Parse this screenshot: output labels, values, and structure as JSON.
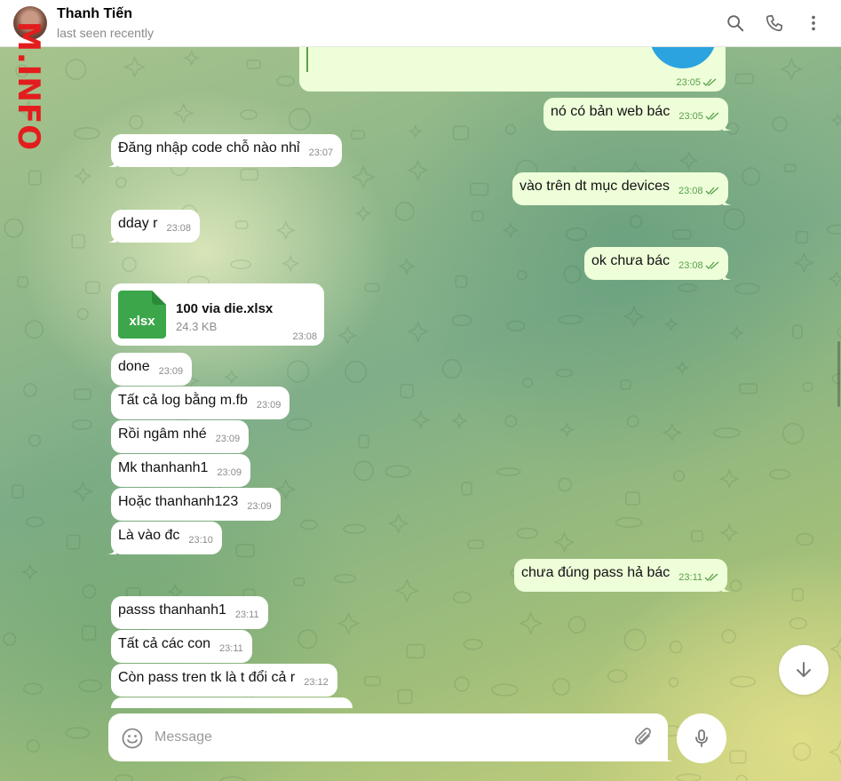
{
  "header": {
    "contact_name": "Thanh Tiến",
    "status": "last seen recently",
    "icons": [
      "search-icon",
      "phone-icon",
      "more-vertical-icon"
    ]
  },
  "watermark": "M.INFO",
  "top_card": {
    "time": "23:05"
  },
  "messages": [
    {
      "dir": "out",
      "text": "nó có bản web bác",
      "time": "23:05",
      "read": true
    },
    {
      "dir": "in",
      "text": "Đăng nhập code chỗ nào nhỉ",
      "time": "23:07"
    },
    {
      "dir": "out",
      "text": "vào trên dt mục devices",
      "time": "23:08",
      "read": true
    },
    {
      "dir": "in",
      "text": "dday r",
      "time": "23:08"
    },
    {
      "dir": "out",
      "text": "ok chưa bác",
      "time": "23:08",
      "read": true
    },
    {
      "dir": "in",
      "text": "done",
      "time": "23:09"
    },
    {
      "dir": "in",
      "text": "Tất cả log bằng m.fb",
      "time": "23:09"
    },
    {
      "dir": "in",
      "text": "Rồi ngâm nhé",
      "time": "23:09"
    },
    {
      "dir": "in",
      "text": "Mk thanhanh1",
      "time": "23:09"
    },
    {
      "dir": "in",
      "text": "Hoặc thanhanh123",
      "time": "23:09"
    },
    {
      "dir": "in",
      "text": "Là vào đc",
      "time": "23:10"
    },
    {
      "dir": "out",
      "text": "chưa đúng pass hả bác",
      "time": "23:11",
      "read": true
    },
    {
      "dir": "in",
      "text": "passs thanhanh1",
      "time": "23:11"
    },
    {
      "dir": "in",
      "text": "Tất cả các con",
      "time": "23:11"
    },
    {
      "dir": "in",
      "text": "Còn pass tren tk là t đổi cả r",
      "time": "23:12"
    }
  ],
  "file": {
    "icon_label": "xlsx",
    "name": "100 via die.xlsx",
    "size": "24.3 KB",
    "time": "23:08",
    "icon_color": "#3ba74a"
  },
  "composer": {
    "placeholder": "Message",
    "icons": [
      "emoji-icon",
      "paperclip-icon",
      "microphone-icon"
    ]
  },
  "colors": {
    "incoming_bubble": "#ffffff",
    "outgoing_bubble": "#eefed9",
    "tick_color": "#5aa04c",
    "watermark": "#e31d1d"
  }
}
